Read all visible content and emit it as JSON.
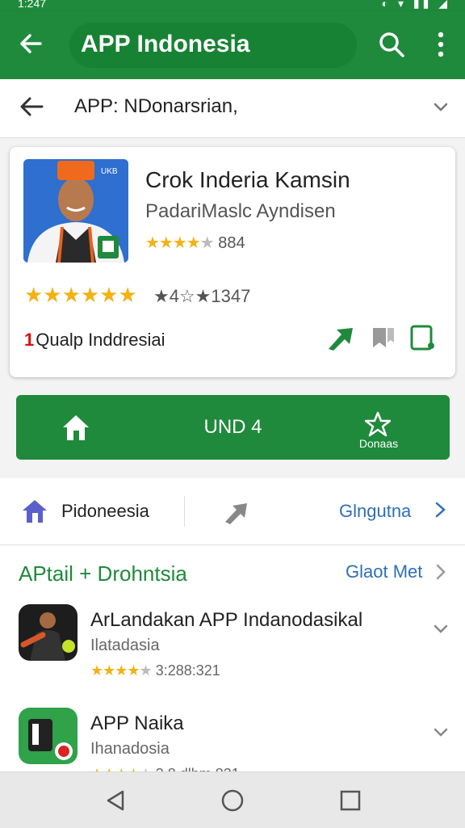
{
  "status_bar": {
    "time": "1:247",
    "icons": "◐ ▾ ▮▮ ◢"
  },
  "app_bar": {
    "title": "APP Indonesia"
  },
  "breadcrumb": {
    "text": "APP: NDonarsrian,"
  },
  "app_card": {
    "name": "Crok Inderia Kamsin",
    "developer": "PadariMaslc Ayndisen",
    "rating_short": "884",
    "rating_count": "★4☆★1347",
    "region_number": "1",
    "region_label": "Qualp Inddresiai",
    "thumb_badge": "UKB"
  },
  "install_bar": {
    "label": "UND 4",
    "secondary_label": "Donaas"
  },
  "tab_row": {
    "label": "Pidoneesia",
    "link": "Glngutna"
  },
  "section": {
    "title": "APtail + Drohntsia",
    "link": "Glaot Met",
    "apps": [
      {
        "title": "ArLandakan APP Indanodasikal",
        "subtitle": "Ilatadasia",
        "rating": "3:288:321",
        "stars": 4
      },
      {
        "title": "APP Naika",
        "subtitle": "Ihanadosia",
        "rating": "3.8 dlhm 821",
        "stars": 4
      }
    ]
  },
  "colors": {
    "primary_green": "#1f8a3c",
    "link_blue": "#2e6fb8",
    "star_yellow": "#f2b215"
  }
}
